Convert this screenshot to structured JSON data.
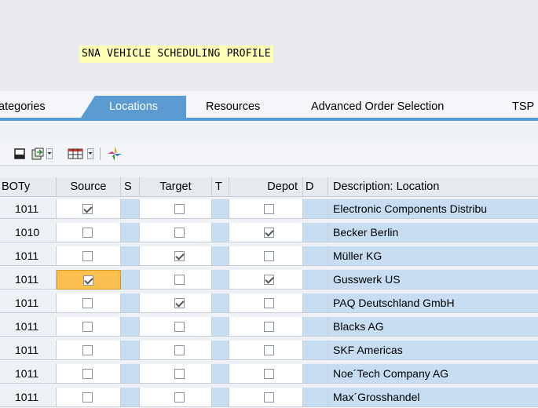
{
  "profile": {
    "title": "SNA VEHICLE SCHEDULING PROFILE"
  },
  "tabs": [
    "ategories",
    "Locations",
    "Resources",
    "Advanced Order Selection",
    "TSP"
  ],
  "active_tab": "Locations",
  "toolbar": {
    "icons": [
      "new-document-icon",
      "export-icon",
      "dropdown-arrow-icon",
      "layout-grid-icon",
      "dropdown-arrow-icon",
      "settings-wizard-icon"
    ]
  },
  "table": {
    "headers": {
      "boty": "BOTy",
      "source": "Source",
      "s": "S",
      "target": "Target",
      "t": "T",
      "depot": "Depot",
      "d": "D",
      "description": "Description: Location"
    },
    "rows": [
      {
        "boty": "1011",
        "source": true,
        "target": false,
        "depot": false,
        "description": "Electronic Components Distribu"
      },
      {
        "boty": "1010",
        "source": false,
        "target": false,
        "depot": true,
        "description": "Becker Berlin"
      },
      {
        "boty": "1011",
        "source": false,
        "target": true,
        "depot": false,
        "description": "Müller KG"
      },
      {
        "boty": "1011",
        "source": true,
        "target": false,
        "depot": true,
        "description": "Gusswerk US"
      },
      {
        "boty": "1011",
        "source": false,
        "target": true,
        "depot": false,
        "description": "PAQ Deutschland GmbH"
      },
      {
        "boty": "1011",
        "source": false,
        "target": false,
        "depot": false,
        "description": "Blacks AG"
      },
      {
        "boty": "1011",
        "source": false,
        "target": false,
        "depot": false,
        "description": "SKF Americas"
      },
      {
        "boty": "1011",
        "source": false,
        "target": false,
        "depot": false,
        "description": "Noe´Tech Company AG"
      },
      {
        "boty": "1011",
        "source": false,
        "target": false,
        "depot": false,
        "description": "Max´Grosshandel"
      }
    ]
  },
  "colors": {
    "tab_active": "#5b9bd2",
    "title_highlight": "#fefeb4",
    "focus_cell": "#fbc04f",
    "blue_column": "#c7ddf1"
  }
}
